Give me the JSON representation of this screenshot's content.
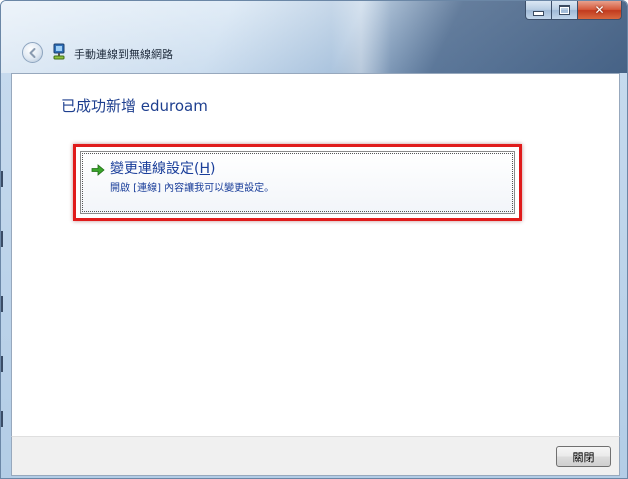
{
  "window": {
    "title": "手動連線到無線網路"
  },
  "icons": {
    "back": "back-arrow-icon",
    "wireless": "wireless-network-icon",
    "command_arrow": "green-arrow-icon"
  },
  "main": {
    "heading": "已成功新增 eduroam",
    "command_link": {
      "title_prefix": "變更連線設定(",
      "accelerator": "H",
      "title_suffix": ")",
      "description": "開啟 [連線] 內容讓我可以變更設定。"
    }
  },
  "footer": {
    "close_label": "關閉"
  },
  "colors": {
    "accent_text": "#1e3f8f",
    "link_text": "#1a3e9a",
    "highlight_frame": "#e01b1b",
    "close_caption": "#c13a1e"
  }
}
